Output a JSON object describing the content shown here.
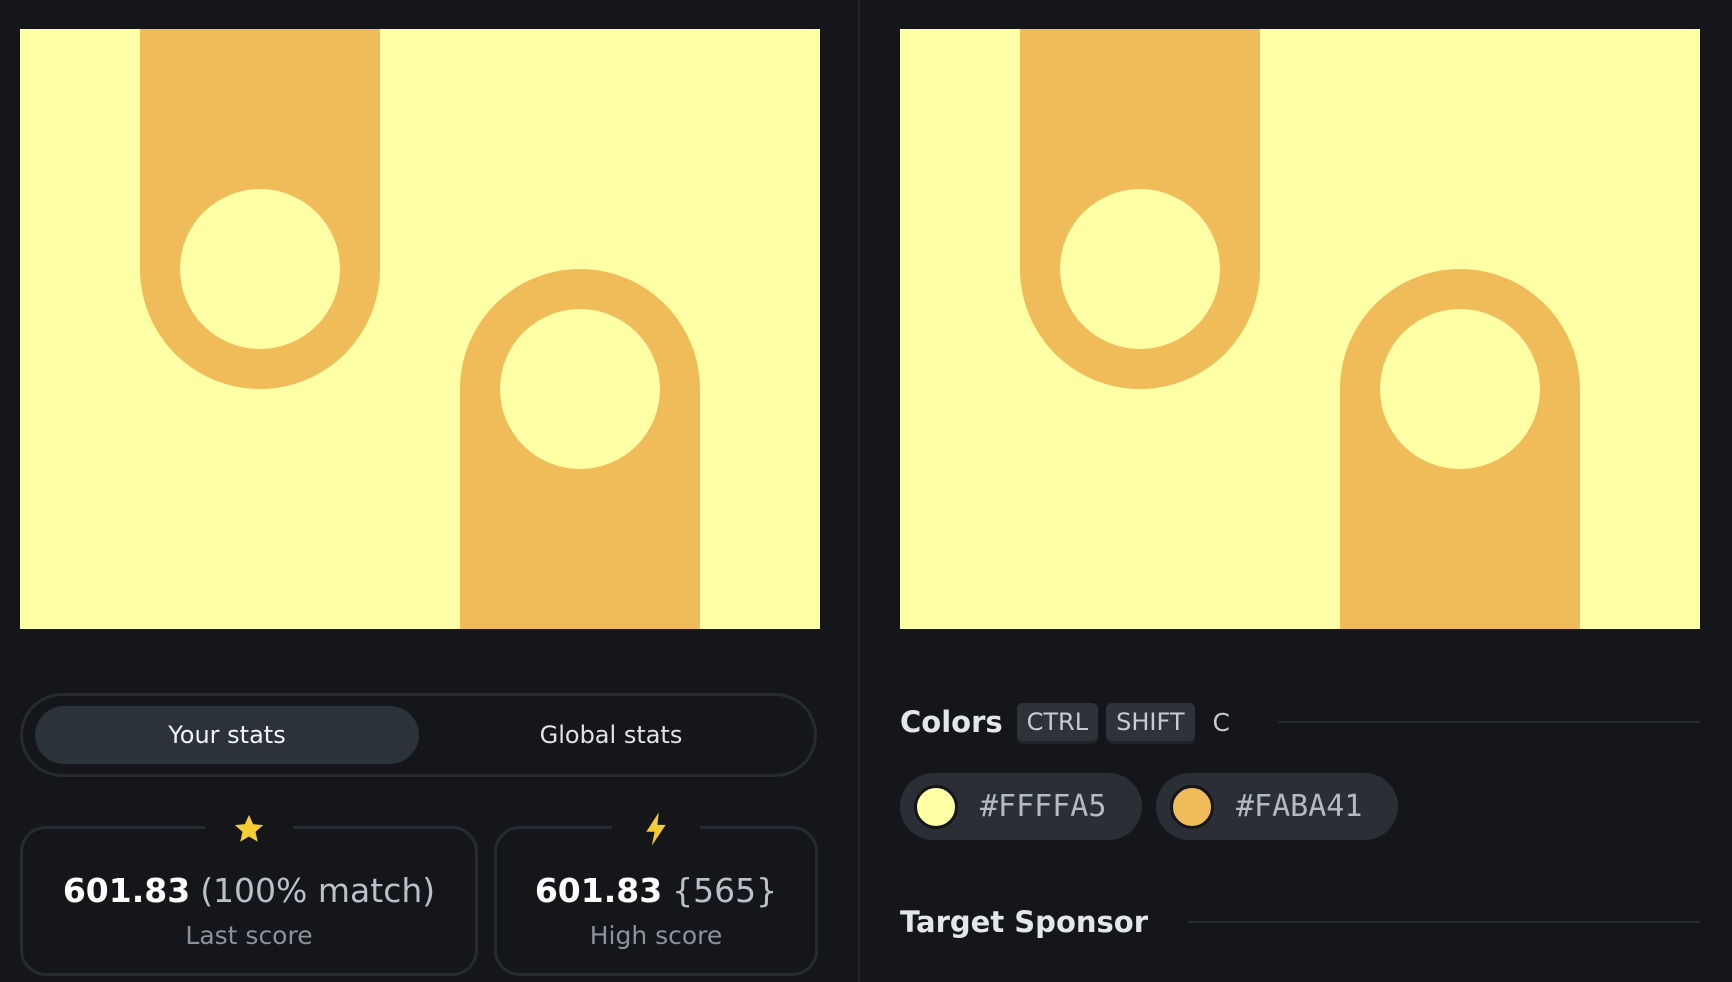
{
  "palette": {
    "background": "#FFFFA5",
    "shape": "#FABA41"
  },
  "stats_toggle": {
    "your_stats_label": "Your stats",
    "global_stats_label": "Global stats",
    "active": "Your stats"
  },
  "last_score": {
    "icon": "star-icon",
    "value": "601.83",
    "extra": "(100% match)",
    "label": "Last score"
  },
  "high_score": {
    "icon": "lightning-icon",
    "value": "601.83",
    "extra": "{565}",
    "label": "High score"
  },
  "colors": {
    "title": "Colors",
    "shortcut_keys": [
      "CTRL",
      "SHIFT"
    ],
    "shortcut_letter": "C",
    "swatches": [
      {
        "hex": "#FFFFA5",
        "color": "#FFFFA5"
      },
      {
        "hex": "#FABA41",
        "color": "#FABA41"
      }
    ]
  },
  "sponsor": {
    "title": "Target Sponsor"
  }
}
